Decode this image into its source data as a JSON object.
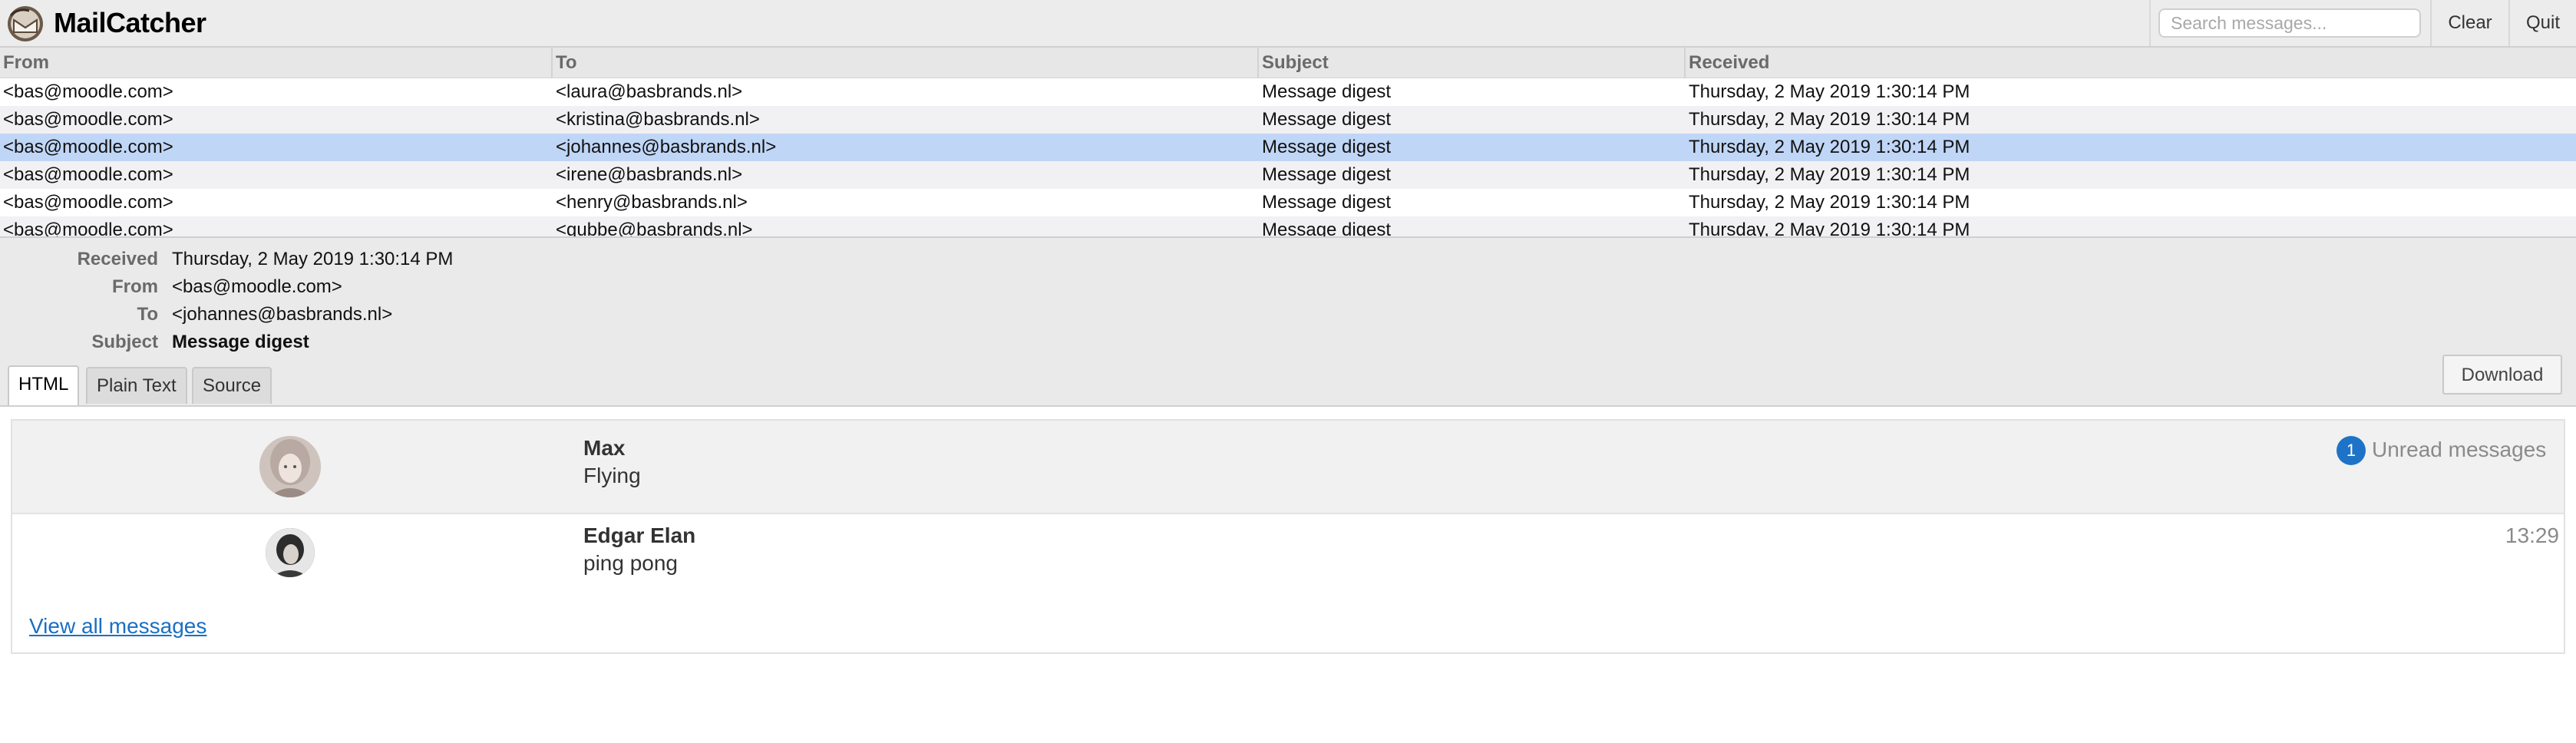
{
  "header": {
    "app_title": "MailCatcher",
    "logo_icon": "mailcatcher-logo-icon",
    "search": {
      "placeholder": "Search messages...",
      "value": ""
    },
    "clear_label": "Clear",
    "quit_label": "Quit"
  },
  "list": {
    "columns": [
      "From",
      "To",
      "Subject",
      "Received"
    ],
    "rows": [
      {
        "from": "<bas@moodle.com>",
        "to": "<laura@basbrands.nl>",
        "subject": "Message digest",
        "received": "Thursday, 2 May 2019 1:30:14 PM"
      },
      {
        "from": "<bas@moodle.com>",
        "to": "<kristina@basbrands.nl>",
        "subject": "Message digest",
        "received": "Thursday, 2 May 2019 1:30:14 PM"
      },
      {
        "from": "<bas@moodle.com>",
        "to": "<johannes@basbrands.nl>",
        "subject": "Message digest",
        "received": "Thursday, 2 May 2019 1:30:14 PM"
      },
      {
        "from": "<bas@moodle.com>",
        "to": "<irene@basbrands.nl>",
        "subject": "Message digest",
        "received": "Thursday, 2 May 2019 1:30:14 PM"
      },
      {
        "from": "<bas@moodle.com>",
        "to": "<henry@basbrands.nl>",
        "subject": "Message digest",
        "received": "Thursday, 2 May 2019 1:30:14 PM"
      },
      {
        "from": "<bas@moodle.com>",
        "to": "<gubbe@basbrands.nl>",
        "subject": "Message digest",
        "received": "Thursday, 2 May 2019 1:30:14 PM"
      }
    ],
    "selected_row": 2
  },
  "detail": {
    "received_label": "Received",
    "received": "Thursday, 2 May 2019 1:30:14 PM",
    "from_label": "From",
    "from": "<bas@moodle.com>",
    "to_label": "To",
    "to": "<johannes@basbrands.nl>",
    "subject_label": "Subject",
    "subject": "Message digest",
    "tabs": [
      "HTML",
      "Plain Text",
      "Source"
    ],
    "active_tab": "HTML",
    "download_label": "Download"
  },
  "digest": {
    "messages": [
      {
        "sender": "Max",
        "snippet": "Flying",
        "unread_count": "1",
        "unread_label": "Unread messages"
      },
      {
        "sender": "Edgar Elan",
        "snippet": "ping pong",
        "time": "13:29"
      }
    ],
    "view_all_label": "View all messages"
  },
  "colors": {
    "selected_row": "#c0d6f6",
    "unread_badge": "#1e73c8",
    "link": "#1a6fc4"
  }
}
